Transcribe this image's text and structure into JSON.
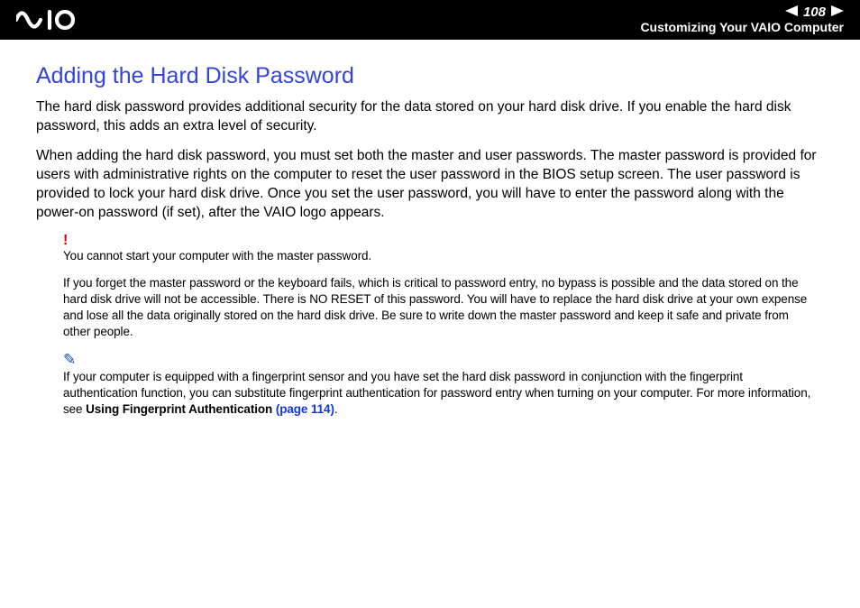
{
  "header": {
    "page_number": "108",
    "section": "Customizing Your VAIO Computer"
  },
  "content": {
    "title": "Adding the Hard Disk Password",
    "para1": "The hard disk password provides additional security for the data stored on your hard disk drive. If you enable the hard disk password, this adds an extra level of security.",
    "para2": "When adding the hard disk password, you must set both the master and user passwords. The master password is provided for users with administrative rights on the computer to reset the user password in the BIOS setup screen. The user password is provided to lock your hard disk drive. Once you set the user password, you will have to enter the password along with the power-on password (if set), after the VAIO logo appears.",
    "warning": {
      "icon": "!",
      "line1": "You cannot start your computer with the master password.",
      "line2": "If you forget the master password or the keyboard fails, which is critical to password entry, no bypass is possible and the data stored on the hard disk drive will not be accessible. There is NO RESET of this password. You will have to replace the hard disk drive at your own expense and lose all the data originally stored on the hard disk drive. Be sure to write down the master password and keep it safe and private from other people."
    },
    "tip": {
      "icon": "✎",
      "text_prefix": "If your computer is equipped with a fingerprint sensor and you have set the hard disk password in conjunction with the fingerprint authentication function, you can substitute fingerprint authentication for password entry when turning on your computer. For more information, see ",
      "bold_text": "Using Fingerprint Authentication ",
      "link_text": "(page 114)",
      "suffix": "."
    }
  }
}
